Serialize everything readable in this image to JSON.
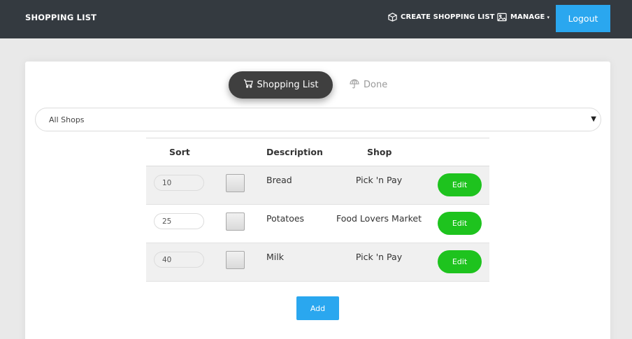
{
  "navbar": {
    "brand": "SHOPPING LIST",
    "create_label": "CREATE SHOPPING LIST",
    "create_icon": "box-icon",
    "manage_label": "MANAGE",
    "manage_icon": "image-icon",
    "manage_caret": "▾",
    "logout_label": "Logout",
    "bg_color": "#343a40",
    "accent_color": "#2aa7ef"
  },
  "tabs": {
    "active_label": "Shopping List",
    "active_icon": "cart-icon",
    "inactive_label": "Done",
    "inactive_icon": "umbrella-icon"
  },
  "filter": {
    "selected": "All Shops",
    "arrow": "▼"
  },
  "table": {
    "headers": {
      "sort": "Sort",
      "description": "Description",
      "shop": "Shop"
    },
    "rows": [
      {
        "sort": "10",
        "description": "Bread",
        "shop": "Pick 'n Pay",
        "edit": "Edit"
      },
      {
        "sort": "25",
        "description": "Potatoes",
        "shop": "Food Lovers Market",
        "edit": "Edit"
      },
      {
        "sort": "40",
        "description": "Milk",
        "shop": "Pick 'n Pay",
        "edit": "Edit"
      }
    ]
  },
  "add_label": "Add",
  "colors": {
    "edit_green": "#1ec31e",
    "pill_dark": "#3f3f3f"
  }
}
